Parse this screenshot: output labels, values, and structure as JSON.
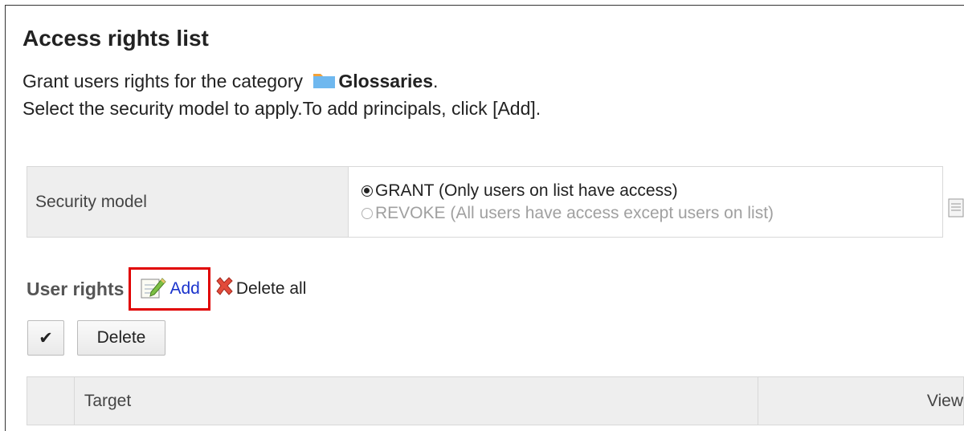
{
  "page": {
    "title": "Access rights list",
    "desc_prefix": "Grant users rights for the category ",
    "category_name": "Glossaries",
    "desc_suffix": ".",
    "desc_line2": "Select the security model to apply.To add principals, click [Add]."
  },
  "security": {
    "label": "Security model",
    "options": [
      {
        "label": "GRANT (Only users on list have access)",
        "selected": true
      },
      {
        "label": "REVOKE (All users have access except users on list)",
        "selected": false
      }
    ]
  },
  "user_rights": {
    "label": "User rights",
    "add_label": "Add",
    "delete_all_label": "Delete all"
  },
  "buttons": {
    "check_glyph": "✔",
    "delete_label": "Delete"
  },
  "list": {
    "columns": [
      "",
      "Target",
      "View"
    ]
  },
  "colors": {
    "highlight_box": "#e00000",
    "link": "#1a33cc",
    "header_bg": "#eeeeee"
  }
}
